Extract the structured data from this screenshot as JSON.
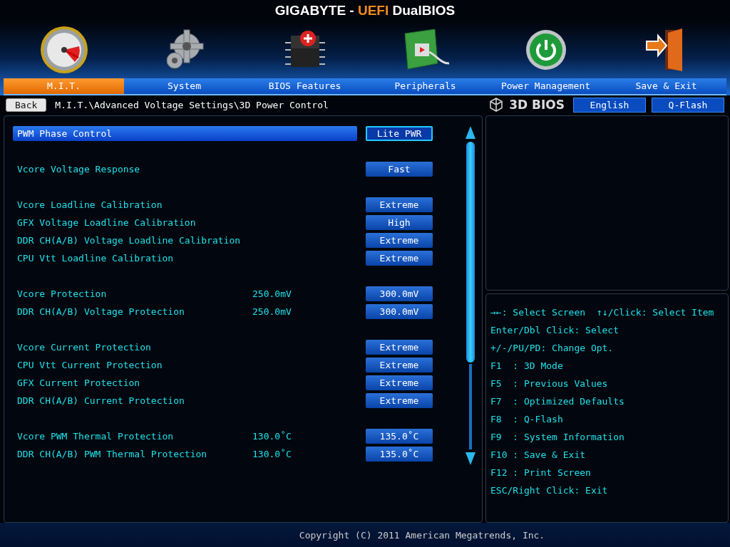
{
  "header": {
    "brand": "GIGABYTE - ",
    "highlight": "UEFI",
    "product": " DualBIOS"
  },
  "tabs": [
    {
      "label": "M.I.T.",
      "selected": true
    },
    {
      "label": "System",
      "selected": false
    },
    {
      "label": "BIOS Features",
      "selected": false
    },
    {
      "label": "Peripherals",
      "selected": false
    },
    {
      "label": "Power Management",
      "selected": false
    },
    {
      "label": "Save & Exit",
      "selected": false
    }
  ],
  "breadcrumb": {
    "back": "Back",
    "path": "M.I.T.\\Advanced Voltage Settings\\3D Power Control"
  },
  "top_right": {
    "logo": "3D BIOS",
    "language": "English",
    "qflash": "Q-Flash"
  },
  "settings": [
    [
      {
        "label": "PWM Phase Control",
        "value": "Lite PWR",
        "selected": true
      }
    ],
    [
      {
        "label": "Vcore Voltage Response",
        "value": "Fast",
        "selected": false
      }
    ],
    [
      {
        "label": "Vcore Loadline Calibration",
        "value": "Extreme",
        "selected": false
      },
      {
        "label": "GFX Voltage Loadline Calibration",
        "value": "High",
        "selected": false
      },
      {
        "label": "DDR CH(A/B) Voltage Loadline Calibration",
        "value": "Extreme",
        "selected": false
      },
      {
        "label": "CPU Vtt Loadline Calibration",
        "value": "Extreme",
        "selected": false
      }
    ],
    [
      {
        "label": "Vcore Protection",
        "current": "250.0mV",
        "value": "300.0mV",
        "selected": false
      },
      {
        "label": "DDR CH(A/B) Voltage Protection",
        "current": "250.0mV",
        "value": "300.0mV",
        "selected": false
      }
    ],
    [
      {
        "label": "Vcore Current Protection",
        "value": "Extreme",
        "selected": false
      },
      {
        "label": "CPU Vtt Current Protection",
        "value": "Extreme",
        "selected": false
      },
      {
        "label": "GFX Current Protection",
        "value": "Extreme",
        "selected": false
      },
      {
        "label": "DDR CH(A/B) Current Protection",
        "value": "Extreme",
        "selected": false
      }
    ],
    [
      {
        "label": "Vcore PWM Thermal Protection",
        "current": "130.0˚C",
        "value": "135.0˚C",
        "selected": false
      },
      {
        "label": "DDR CH(A/B) PWM Thermal Protection",
        "current": "130.0˚C",
        "value": "135.0˚C",
        "selected": false
      }
    ]
  ],
  "help": [
    [
      "→←: Select Screen",
      "↑↓/Click: Select Item"
    ],
    [
      "Enter/Dbl Click: Select"
    ],
    [
      "+/-/PU/PD: Change Opt."
    ],
    [
      "F1  : 3D Mode"
    ],
    [
      "F5  : Previous Values"
    ],
    [
      "F7  : Optimized Defaults"
    ],
    [
      "F8  : Q-Flash"
    ],
    [
      "F9  : System Information"
    ],
    [
      "F10 : Save & Exit"
    ],
    [
      "F12 : Print Screen"
    ],
    [
      "ESC/Right Click: Exit"
    ]
  ],
  "footer": {
    "copyright": "Copyright (C) 2011 American Megatrends, Inc."
  }
}
